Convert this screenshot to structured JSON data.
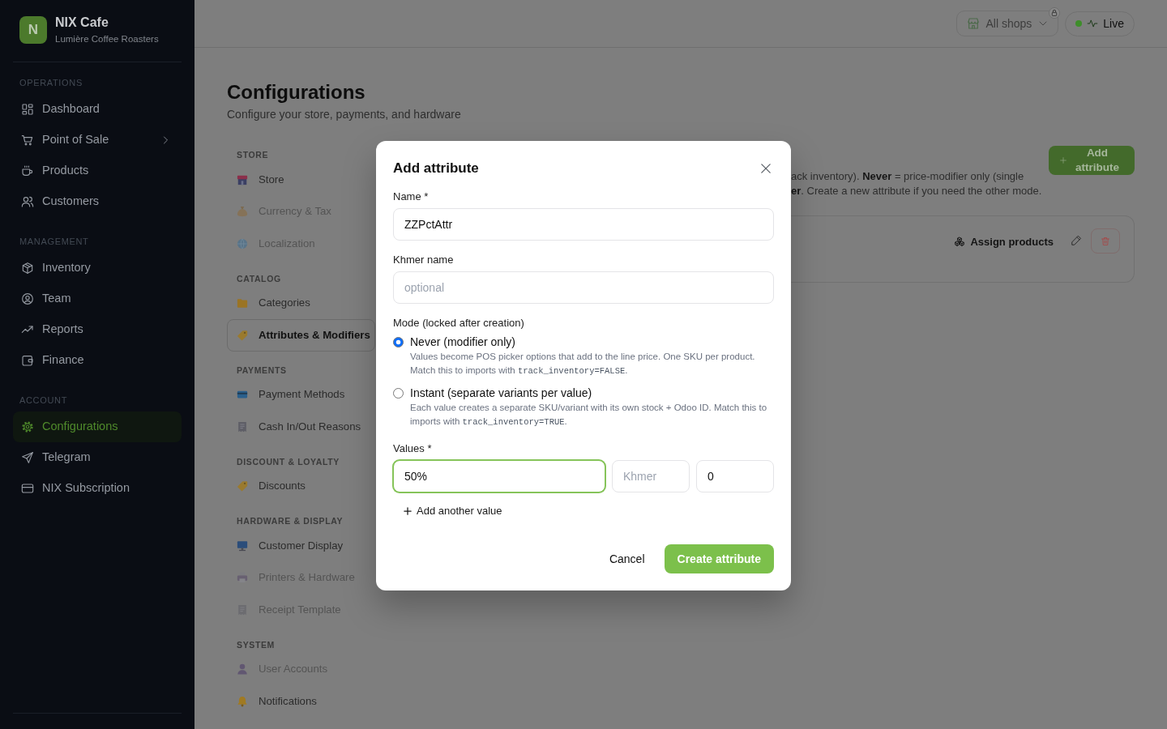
{
  "sidebar": {
    "brand": {
      "initial": "N",
      "name": "NIX Cafe",
      "subtitle": "Lumière Coffee Roasters"
    },
    "sections": [
      {
        "label": "OPERATIONS",
        "items": [
          {
            "label": "Dashboard",
            "selected": false,
            "submenu": false
          },
          {
            "label": "Point of Sale",
            "selected": false,
            "submenu": true
          },
          {
            "label": "Products",
            "selected": false,
            "submenu": false
          },
          {
            "label": "Customers",
            "selected": false,
            "submenu": false
          }
        ]
      },
      {
        "label": "MANAGEMENT",
        "items": [
          {
            "label": "Inventory",
            "selected": false,
            "submenu": false
          },
          {
            "label": "Team",
            "selected": false,
            "submenu": false
          },
          {
            "label": "Reports",
            "selected": false,
            "submenu": false
          },
          {
            "label": "Finance",
            "selected": false,
            "submenu": false
          }
        ]
      },
      {
        "label": "ACCOUNT",
        "items": [
          {
            "label": "Configurations",
            "selected": true,
            "submenu": false
          },
          {
            "label": "Telegram",
            "selected": false,
            "submenu": false
          },
          {
            "label": "NIX Subscription",
            "selected": false,
            "submenu": false
          }
        ]
      }
    ]
  },
  "header": {
    "shop_selector": {
      "label": "All shops"
    },
    "status": {
      "label": "Live"
    }
  },
  "page": {
    "title": "Configurations",
    "subtitle": "Configure your store, payments, and hardware"
  },
  "config_nav": {
    "sections": [
      {
        "label": "STORE",
        "items": [
          {
            "label": "Store",
            "selected": false,
            "disabled": false
          },
          {
            "label": "Currency & Tax",
            "selected": false,
            "disabled": true
          },
          {
            "label": "Localization",
            "selected": false,
            "disabled": true
          }
        ]
      },
      {
        "label": "CATALOG",
        "items": [
          {
            "label": "Categories",
            "selected": false,
            "disabled": false
          },
          {
            "label": "Attributes & Modifiers",
            "selected": true,
            "disabled": false
          }
        ]
      },
      {
        "label": "PAYMENTS",
        "items": [
          {
            "label": "Payment Methods",
            "selected": false,
            "disabled": false
          },
          {
            "label": "Cash In/Out Reasons",
            "selected": false,
            "disabled": false
          }
        ]
      },
      {
        "label": "DISCOUNT & LOYALTY",
        "items": [
          {
            "label": "Discounts",
            "selected": false,
            "disabled": false
          }
        ]
      },
      {
        "label": "HARDWARE & DISPLAY",
        "items": [
          {
            "label": "Customer Display",
            "selected": false,
            "disabled": false
          },
          {
            "label": "Printers & Hardware",
            "selected": false,
            "disabled": true
          },
          {
            "label": "Receipt Template",
            "selected": false,
            "disabled": true
          }
        ]
      },
      {
        "label": "SYSTEM",
        "items": [
          {
            "label": "User Accounts",
            "selected": false,
            "disabled": true
          },
          {
            "label": "Notifications",
            "selected": false,
            "disabled": false
          }
        ]
      }
    ]
  },
  "content": {
    "add_button": "Add attribute",
    "description_lines": [
      "ack inventory). **Never** = price-modifier only (single",
      "**er**. Create a new attribute if you need the other mode."
    ],
    "attribute_row": {
      "assign_button": "Assign products"
    }
  },
  "modal": {
    "title": "Add attribute",
    "fields": [
      {
        "label": "Name *",
        "value": "ZZPctAttr"
      },
      {
        "label": "Khmer name",
        "placeholder": "optional"
      }
    ],
    "mode": {
      "label": "Mode (locked after creation)",
      "options": [
        {
          "label": "Never (modifier only)",
          "selected": true,
          "description": [
            {
              "kind": "text",
              "text": "Values become POS picker options that add to the line price. One SKU per product. Match this to imports with "
            },
            {
              "kind": "code",
              "text": "track_inventory=FALSE"
            },
            {
              "kind": "text",
              "text": "."
            }
          ]
        },
        {
          "label": "Instant (separate variants per value)",
          "selected": false,
          "description": [
            {
              "kind": "text",
              "text": "Each value creates a separate SKU/variant with its own stock + Odoo ID. Match this to imports with "
            },
            {
              "kind": "code",
              "text": "track_inventory=TRUE"
            },
            {
              "kind": "text",
              "text": "."
            }
          ]
        }
      ]
    },
    "values": {
      "label": "Values *",
      "rows": [
        {
          "name": "50%",
          "focused": true,
          "khmer_placeholder": "Khmer",
          "price": "0"
        }
      ],
      "add_label": "Add another value"
    },
    "buttons": {
      "cancel": "Cancel",
      "create": "Create attribute"
    }
  }
}
